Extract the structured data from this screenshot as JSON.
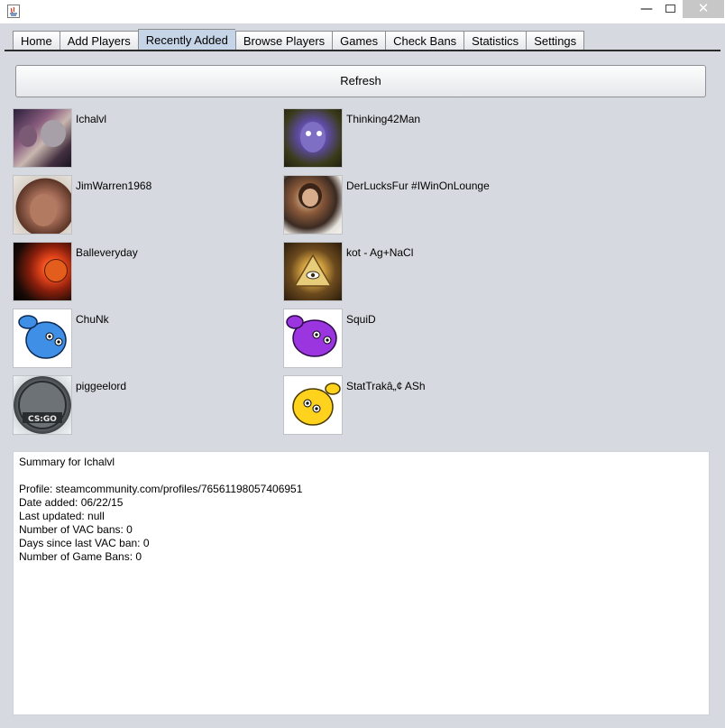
{
  "tabs": [
    {
      "label": "Home"
    },
    {
      "label": "Add Players"
    },
    {
      "label": "Recently Added",
      "active": true
    },
    {
      "label": "Browse Players"
    },
    {
      "label": "Games"
    },
    {
      "label": "Check Bans"
    },
    {
      "label": "Statistics"
    },
    {
      "label": "Settings"
    }
  ],
  "window_controls": {
    "minimize": "—",
    "close": "✕"
  },
  "refresh_label": "Refresh",
  "players": [
    {
      "name": "Ichalvl",
      "avatar": "ichalvl-avatar"
    },
    {
      "name": "Thinking42Man",
      "avatar": "thinking42man-avatar"
    },
    {
      "name": "JimWarren1968",
      "avatar": "jimwarren1968-avatar"
    },
    {
      "name": "DerLucksFur #IWinOnLounge",
      "avatar": "derlucksfur-avatar"
    },
    {
      "name": "Balleveryday",
      "avatar": "balleveryday-avatar"
    },
    {
      "name": "kot - Ag+NaCl",
      "avatar": "kot-avatar"
    },
    {
      "name": "ChuNk",
      "avatar": "chunk-avatar"
    },
    {
      "name": "SquiD",
      "avatar": "squid-avatar"
    },
    {
      "name": "piggeelord",
      "avatar": "piggeelord-avatar"
    },
    {
      "name": "StatTrakâ„¢ ASh",
      "avatar": "stattrak-ash-avatar"
    }
  ],
  "summary": {
    "title": "Summary for Ichalvl",
    "lines": [
      "Profile: steamcommunity.com/profiles/76561198057406951",
      "Date added: 06/22/15",
      "Last updated: null",
      "Number of VAC bans: 0",
      "Days since last VAC ban: 0",
      "Number of Game Bans: 0"
    ]
  },
  "avatar_overlay_text": {
    "piggeelord": "CS:GO"
  },
  "colors": {
    "background": "#d6d9df",
    "active_tab": "#c5d4e6",
    "close_button": "#c7c7c7"
  }
}
